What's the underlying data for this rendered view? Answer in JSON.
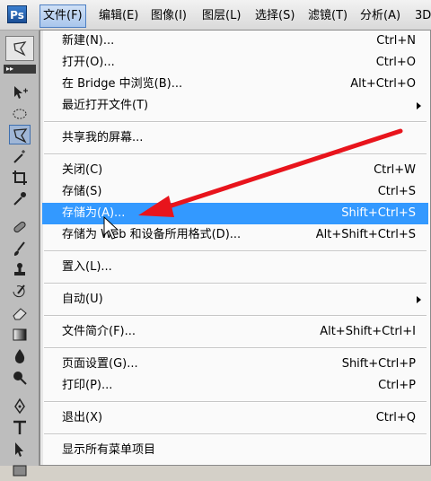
{
  "app": {
    "logo_text": "Ps"
  },
  "menubar": {
    "items": [
      {
        "label": "文件(F)",
        "active": true
      },
      {
        "label": "编辑(E)"
      },
      {
        "label": "图像(I)"
      },
      {
        "label": "图层(L)"
      },
      {
        "label": "选择(S)"
      },
      {
        "label": "滤镜(T)"
      },
      {
        "label": "分析(A)"
      },
      {
        "label": "3D"
      }
    ]
  },
  "tools": {
    "grip": "▸▸",
    "icons": [
      "move-tool-icon",
      "marquee-tool-icon",
      "lasso-tool-icon",
      "magic-wand-icon",
      "crop-tool-icon",
      "eyedropper-icon",
      "healing-brush-icon",
      "brush-tool-icon",
      "clone-stamp-icon",
      "history-brush-icon",
      "eraser-icon",
      "gradient-tool-icon",
      "blur-tool-icon",
      "dodge-tool-icon",
      "pen-tool-icon",
      "type-tool-icon",
      "path-select-icon",
      "rectangle-tool-icon"
    ]
  },
  "file_menu": {
    "items": [
      {
        "label": "新建(N)...",
        "shortcut": "Ctrl+N"
      },
      {
        "label": "打开(O)...",
        "shortcut": "Ctrl+O"
      },
      {
        "label": "在 Bridge 中浏览(B)...",
        "shortcut": "Alt+Ctrl+O"
      },
      {
        "label": "最近打开文件(T)",
        "shortcut": "",
        "submenu": true
      },
      {
        "label": "共享我的屏幕...",
        "shortcut": ""
      },
      {
        "label": "关闭(C)",
        "shortcut": "Ctrl+W"
      },
      {
        "label": "存储(S)",
        "shortcut": "Ctrl+S"
      },
      {
        "label": "存储为(A)...",
        "shortcut": "Shift+Ctrl+S",
        "highlighted": true
      },
      {
        "label": "存储为 Web 和设备所用格式(D)...",
        "shortcut": "Alt+Shift+Ctrl+S"
      },
      {
        "label": "置入(L)...",
        "shortcut": ""
      },
      {
        "label": "自动(U)",
        "shortcut": "",
        "submenu": true
      },
      {
        "label": "文件简介(F)...",
        "shortcut": "Alt+Shift+Ctrl+I"
      },
      {
        "label": "页面设置(G)...",
        "shortcut": "Shift+Ctrl+P"
      },
      {
        "label": "打印(P)...",
        "shortcut": "Ctrl+P"
      },
      {
        "label": "退出(X)",
        "shortcut": "Ctrl+Q"
      },
      {
        "label": "显示所有菜单项目",
        "shortcut": ""
      }
    ]
  },
  "colors": {
    "highlight": "#3399ff",
    "annotation_arrow": "#e8141c"
  }
}
